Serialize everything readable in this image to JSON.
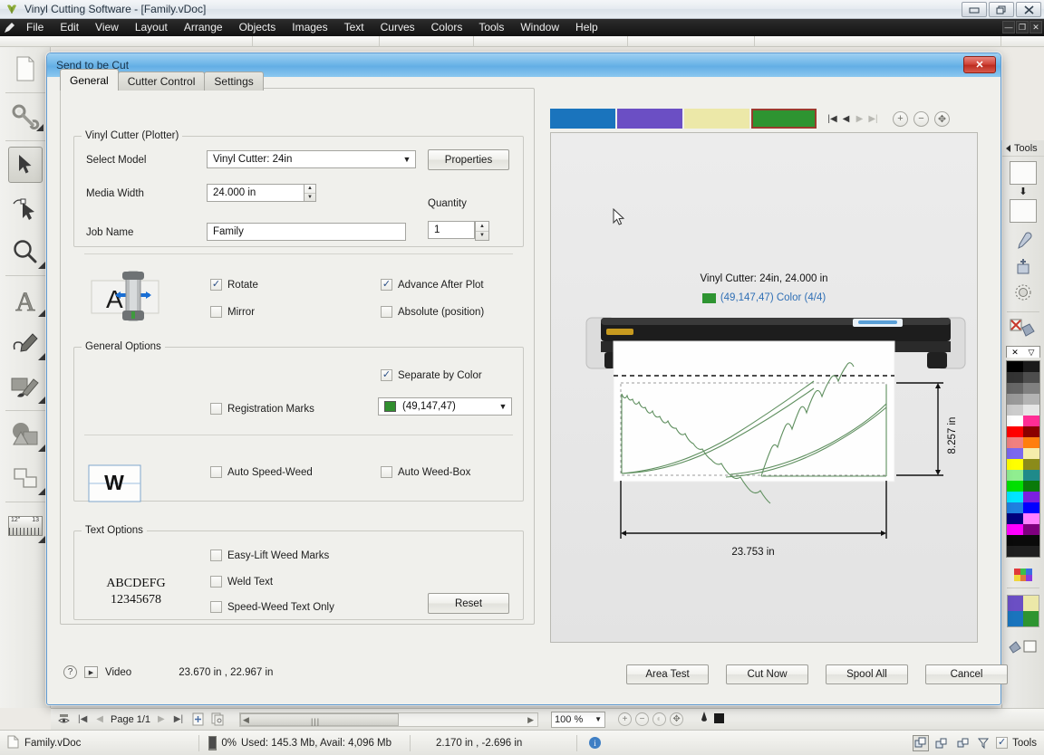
{
  "window": {
    "title": "Vinyl Cutting Software - [Family.vDoc]",
    "icon": "app-icon",
    "buttons": {
      "minimize": "—",
      "maximize": "❐",
      "close": "✕"
    },
    "inner_buttons": {
      "minimize": "—",
      "restore": "❐",
      "close": "✕"
    }
  },
  "menubar": {
    "logo": "pen-icon",
    "items": [
      "File",
      "Edit",
      "View",
      "Layout",
      "Arrange",
      "Objects",
      "Images",
      "Text",
      "Curves",
      "Colors",
      "Tools",
      "Window",
      "Help"
    ]
  },
  "left_toolbar": {
    "items": [
      {
        "name": "new-document-tool",
        "icon": "page-icon"
      },
      {
        "name": "settings-tool",
        "icon": "gear-wrench-icon"
      },
      {
        "name": "select-tool",
        "icon": "arrow-cursor-icon",
        "selected": true
      },
      {
        "name": "node-edit-tool",
        "icon": "node-cursor-icon"
      },
      {
        "name": "zoom-tool",
        "icon": "magnifier-icon"
      },
      {
        "name": "text-tool",
        "icon": "letter-a-icon"
      },
      {
        "name": "pen-tool",
        "icon": "pen-curve-icon"
      },
      {
        "name": "brush-tool",
        "icon": "paintbrush-icon"
      },
      {
        "name": "shapes-tool",
        "icon": "shapes-icon"
      },
      {
        "name": "weld-tool",
        "icon": "weld-shapes-icon"
      },
      {
        "name": "measure-tool",
        "icon": "ruler-icon",
        "label_left": "12\"",
        "label_right": "13"
      }
    ]
  },
  "right_panel": {
    "title": "Tools",
    "fill_swatch": "#fbfbfa",
    "line_swatch": "#fbfbfa",
    "icons": [
      "eyedropper-icon",
      "paint-bucket-icon",
      "pattern-icon",
      "no-fill-icon"
    ],
    "palette_header": {
      "none": "✕",
      "gradient": "▽"
    },
    "palette": [
      [
        "#000000",
        "#1a1a1a"
      ],
      [
        "#333333",
        "#4d4d4d"
      ],
      [
        "#666666",
        "#808080"
      ],
      [
        "#999999",
        "#b3b3b3"
      ],
      [
        "#cccccc",
        "#e6e6e6"
      ],
      [
        "#ffffff",
        "#ff2d95"
      ],
      [
        "#ff0000",
        "#8b0000"
      ],
      [
        "#f08080",
        "#ff7f0e"
      ],
      [
        "#7b68ee",
        "#f5edab"
      ],
      [
        "#ffff00",
        "#8b8b1a"
      ],
      [
        "#90ee90",
        "#1f8a8a"
      ],
      [
        "#00e000",
        "#0a7a0a"
      ],
      [
        "#00e5ff",
        "#7b1fe0"
      ],
      [
        "#1f7fe0",
        "#0000ff"
      ],
      [
        "#00007f",
        "#ff7fff"
      ],
      [
        "#ff00ff",
        "#7f007f"
      ],
      [
        "#0a0a0a",
        "#0a0a0a"
      ],
      [
        "#1f1f1f",
        "#1f1f1f"
      ]
    ],
    "quad_colors": [
      "#6b4fc4",
      "#ece8a8",
      "#1a74bd",
      "#2e9431"
    ]
  },
  "dialog": {
    "title": "Send to be Cut",
    "close_label": "✕",
    "tabs": [
      {
        "label": "General",
        "active": true
      },
      {
        "label": "Cutter Control",
        "active": false
      },
      {
        "label": "Settings",
        "active": false
      }
    ],
    "vinyl_cutter": {
      "legend": "Vinyl Cutter (Plotter)",
      "select_model_label": "Select Model",
      "select_model_value": "Vinyl Cutter: 24in",
      "properties_button": "Properties",
      "media_width_label": "Media Width",
      "media_width_value": "24.000 in",
      "job_name_label": "Job Name",
      "job_name_value": "Family",
      "quantity_label": "Quantity",
      "quantity_value": "1",
      "preview_icon": "rotate-media-icon",
      "preview_icon_letter": "A",
      "checkboxes": [
        {
          "label": "Rotate",
          "checked": true
        },
        {
          "label": "Advance After Plot",
          "checked": true
        },
        {
          "label": "Mirror",
          "checked": false
        },
        {
          "label": "Absolute (position)",
          "checked": false
        }
      ]
    },
    "general_options": {
      "legend": "General Options",
      "separate_by_color": {
        "label": "Separate by Color",
        "checked": true
      },
      "registration_marks": {
        "label": "Registration Marks",
        "checked": false
      },
      "color_combo_value": "(49,147,47)",
      "color_combo_swatch": "#318f2f",
      "weed_icon_letter": "W",
      "auto_speed_weed": {
        "label": "Auto Speed-Weed",
        "checked": false
      },
      "auto_weed_box": {
        "label": "Auto Weed-Box",
        "checked": false
      }
    },
    "text_options": {
      "legend": "Text Options",
      "sample_line1": "ABCDEFG",
      "sample_line2": "12345678",
      "easy_lift": {
        "label": "Easy-Lift Weed Marks",
        "checked": false
      },
      "weld_text": {
        "label": "Weld Text",
        "checked": false
      },
      "speed_weed_text": {
        "label": "Speed-Weed Text Only",
        "checked": false
      },
      "reset_button": "Reset"
    },
    "footer": {
      "help_icon": "question-icon",
      "video_icon": "play-icon",
      "video_label": "Video",
      "dimensions": "23.670 in , 22.967 in",
      "buttons": [
        "Area Test",
        "Cut Now",
        "Spool All",
        "Cancel"
      ]
    },
    "preview": {
      "color_swatches": [
        {
          "color": "#1a74bd",
          "selected": false
        },
        {
          "color": "#6b4fc4",
          "selected": false
        },
        {
          "color": "#ece8a8",
          "selected": false
        },
        {
          "color": "#2e9431",
          "selected": true
        }
      ],
      "nav": {
        "first": "|◀",
        "prev": "◀",
        "next": "▶",
        "last": "▶|"
      },
      "zoom_in": "+",
      "zoom_out": "−",
      "fit": "✥",
      "caption_line1": "Vinyl Cutter: 24in,  24.000 in",
      "caption_swatch": "#2e9431",
      "caption_line2": "(49,147,47) Color (4/4)",
      "dim_height": "8.257 in",
      "dim_width": "23.753 in",
      "design_color": "#5f8f5f"
    }
  },
  "pagebar": {
    "eye_icon": "page-view-icon",
    "first": "|◀",
    "prev": "◀",
    "page_label": "Page 1/1",
    "next": "▶",
    "last": "▶|",
    "add_page_icon": "add-page-icon",
    "copy_page_icon": "copy-page-icon",
    "scroll_left": "◀",
    "scroll_right": "▶",
    "zoom_value": "100 %",
    "zoom_arrow": "▼"
  },
  "statusbar": {
    "doc_icon": "document-icon",
    "doc_name": "Family.vDoc",
    "memory_percent": "0%",
    "memory_text": "Used: 145.3 Mb, Avail: 4,096 Mb",
    "coordinates": "2.170 in , -2.696 in",
    "info_icon": "info-icon",
    "tools_label": "Tools",
    "tools_checked": true
  }
}
